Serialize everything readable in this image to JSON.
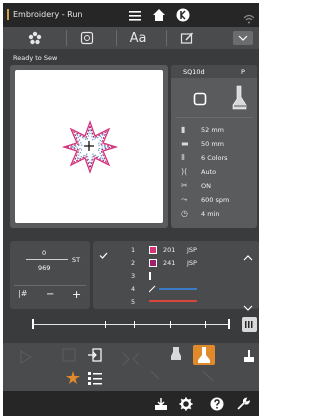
{
  "app": {
    "title": "Embroidery - Run"
  },
  "toolbar": {
    "text_label": "Aa"
  },
  "status": {
    "ready": "Ready to Sew"
  },
  "info": {
    "header_left": "SQ10d",
    "header_right": "P",
    "rows": [
      {
        "icon": "height-icon",
        "value": "52 mm"
      },
      {
        "icon": "width-icon",
        "value": "50 mm"
      },
      {
        "icon": "spool-icon",
        "value": "6 Colors"
      },
      {
        "icon": "thread-cut-icon",
        "value": "Auto"
      },
      {
        "icon": "scissors-icon",
        "value": "ON"
      },
      {
        "icon": "speed-icon",
        "value": "600 spm"
      },
      {
        "icon": "clock-icon",
        "value": "4 min"
      }
    ]
  },
  "stitch": {
    "current": "0",
    "total": "969",
    "unit": "ST",
    "minus": "−",
    "plus": "+"
  },
  "threads": [
    {
      "num": "1",
      "color": "#d6337a",
      "code": "201",
      "brand": "JSP"
    },
    {
      "num": "2",
      "color": "#a01e6e",
      "code": "241",
      "brand": "JSP"
    },
    {
      "num": "3",
      "color": "#ffffff"
    },
    {
      "num": "4",
      "color": "#3b7bc4"
    },
    {
      "num": "5",
      "color": "#d9463c"
    }
  ],
  "colors": {
    "dark": "#262626",
    "panel": "#4a4b4d",
    "accent_orange": "#e08a2c"
  }
}
